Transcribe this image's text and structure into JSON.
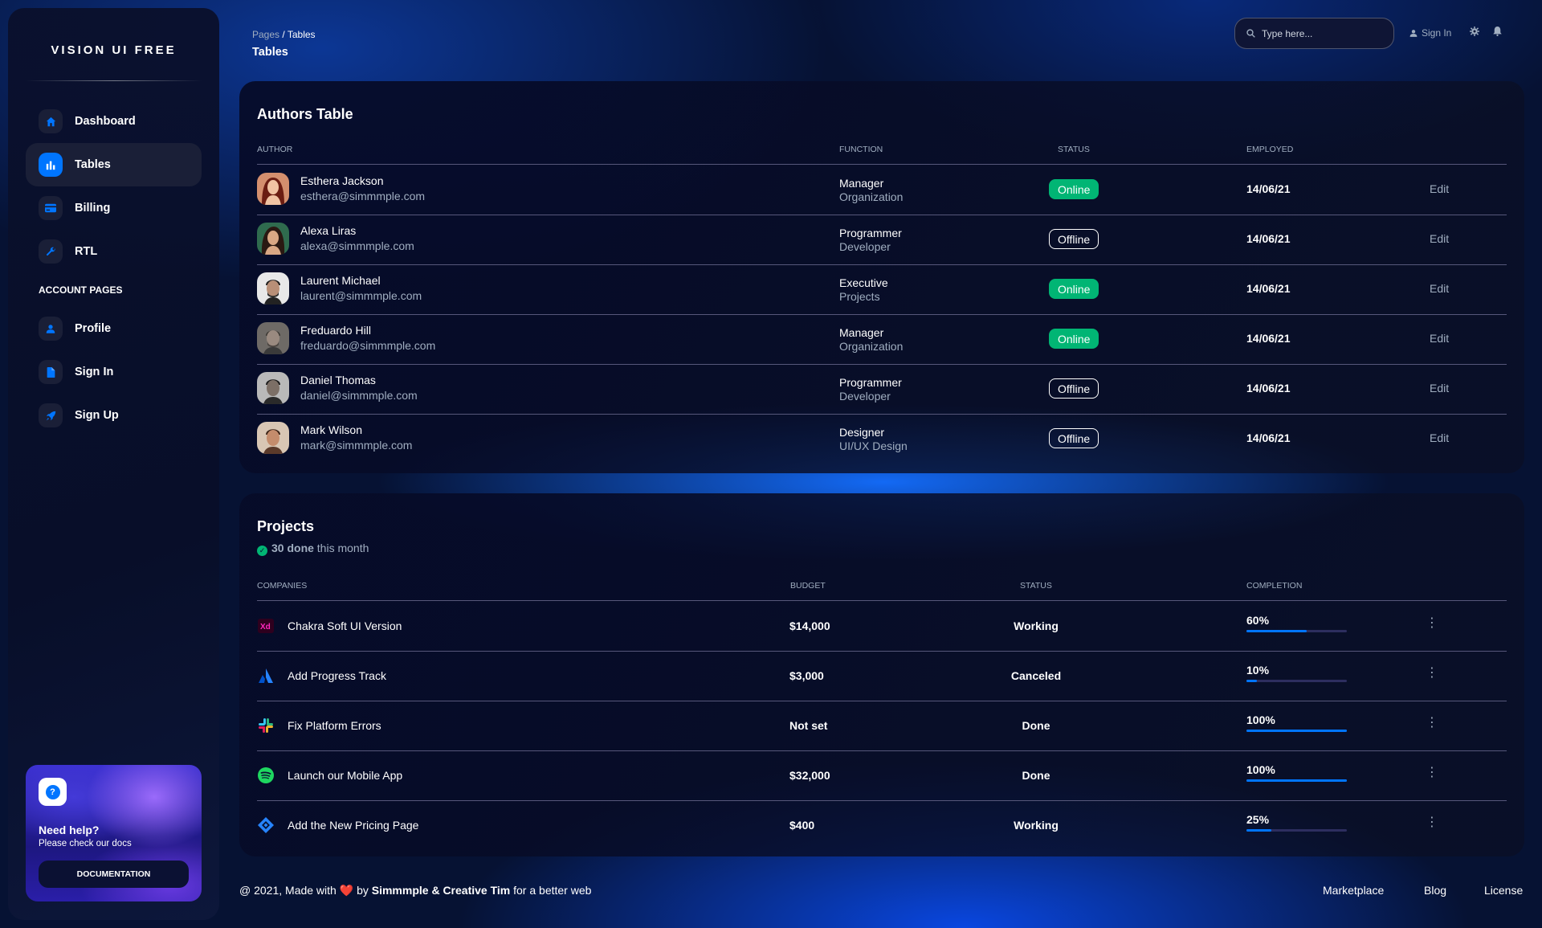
{
  "sidebar": {
    "brand": "VISION UI FREE",
    "items": [
      {
        "label": "Dashboard",
        "icon": "home-icon"
      },
      {
        "label": "Tables",
        "icon": "bar-chart-icon"
      },
      {
        "label": "Billing",
        "icon": "credit-card-icon"
      },
      {
        "label": "RTL",
        "icon": "wrench-icon"
      }
    ],
    "section_label": "ACCOUNT PAGES",
    "account_items": [
      {
        "label": "Profile",
        "icon": "person-icon"
      },
      {
        "label": "Sign In",
        "icon": "document-icon"
      },
      {
        "label": "Sign Up",
        "icon": "rocket-icon"
      }
    ],
    "help": {
      "title": "Need help?",
      "subtitle": "Please check our docs",
      "button": "DOCUMENTATION"
    }
  },
  "header": {
    "breadcrumb_root": "Pages",
    "breadcrumb_sep": "/",
    "breadcrumb_current": "Tables",
    "title": "Tables",
    "search_placeholder": "Type here...",
    "sign_in": "Sign In"
  },
  "authors": {
    "title": "Authors Table",
    "columns": [
      "AUTHOR",
      "FUNCTION",
      "STATUS",
      "EMPLOYED"
    ],
    "rows": [
      {
        "name": "Esthera Jackson",
        "email": "esthera@simmmple.com",
        "function": "Manager",
        "department": "Organization",
        "status": "Online",
        "employed": "14/06/21",
        "action": "Edit"
      },
      {
        "name": "Alexa Liras",
        "email": "alexa@simmmple.com",
        "function": "Programmer",
        "department": "Developer",
        "status": "Offline",
        "employed": "14/06/21",
        "action": "Edit"
      },
      {
        "name": "Laurent Michael",
        "email": "laurent@simmmple.com",
        "function": "Executive",
        "department": "Projects",
        "status": "Online",
        "employed": "14/06/21",
        "action": "Edit"
      },
      {
        "name": "Freduardo Hill",
        "email": "freduardo@simmmple.com",
        "function": "Manager",
        "department": "Organization",
        "status": "Online",
        "employed": "14/06/21",
        "action": "Edit"
      },
      {
        "name": "Daniel Thomas",
        "email": "daniel@simmmple.com",
        "function": "Programmer",
        "department": "Developer",
        "status": "Offline",
        "employed": "14/06/21",
        "action": "Edit"
      },
      {
        "name": "Mark Wilson",
        "email": "mark@simmmple.com",
        "function": "Designer",
        "department": "UI/UX Design",
        "status": "Offline",
        "employed": "14/06/21",
        "action": "Edit"
      }
    ]
  },
  "projects": {
    "title": "Projects",
    "done_count": "30 done",
    "done_suffix": "this month",
    "columns": [
      "COMPANIES",
      "BUDGET",
      "STATUS",
      "COMPLETION"
    ],
    "rows": [
      {
        "name": "Chakra Soft UI Version",
        "logo": "adobe-xd-icon",
        "budget": "$14,000",
        "status": "Working",
        "completion": "60%",
        "progress": 60
      },
      {
        "name": "Add Progress Track",
        "logo": "atlassian-icon",
        "budget": "$3,000",
        "status": "Canceled",
        "completion": "10%",
        "progress": 10
      },
      {
        "name": "Fix Platform Errors",
        "logo": "slack-icon",
        "budget": "Not set",
        "status": "Done",
        "completion": "100%",
        "progress": 100
      },
      {
        "name": "Launch our Mobile App",
        "logo": "spotify-icon",
        "budget": "$32,000",
        "status": "Done",
        "completion": "100%",
        "progress": 100
      },
      {
        "name": "Add the New Pricing Page",
        "logo": "jira-icon",
        "budget": "$400",
        "status": "Working",
        "completion": "25%",
        "progress": 25
      }
    ]
  },
  "footer": {
    "prefix": "@ 2021, Made with",
    "by": "by",
    "authors": "Simmmple & Creative Tim",
    "suffix": "for a better web",
    "links": [
      "Marketplace",
      "Blog",
      "License"
    ]
  },
  "colors": {
    "accent": "#0075ff",
    "online": "#01b574",
    "muted": "#a0aec0"
  }
}
